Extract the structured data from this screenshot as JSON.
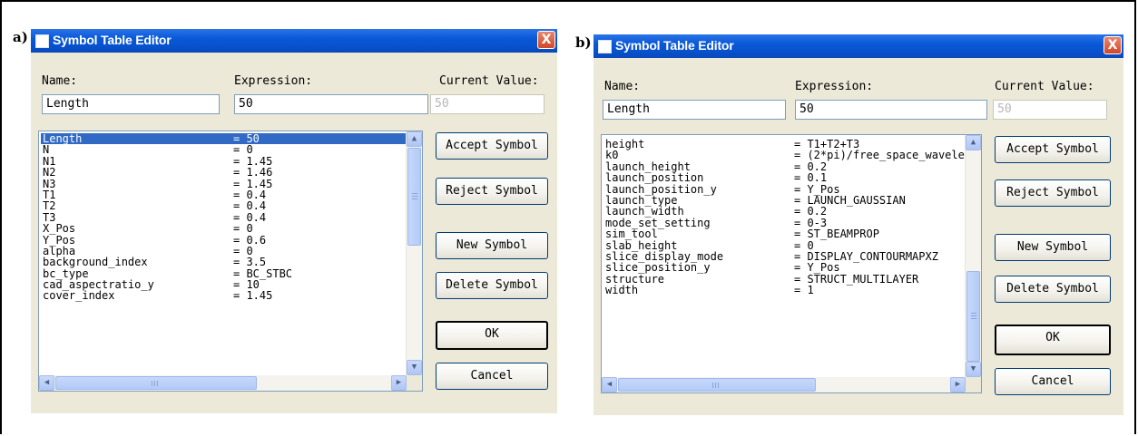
{
  "panels": [
    {
      "label": "a)",
      "title": "Symbol Table Editor",
      "close_glyph": "X",
      "name_label": "Name:",
      "expression_label": "Expression:",
      "current_value_label": "Current Value:",
      "name_value": "Length",
      "expression_value": "50",
      "current_value": "50",
      "buttons": {
        "accept": "Accept Symbol",
        "reject": "Reject Symbol",
        "new": "New Symbol",
        "delete": "Delete Symbol",
        "ok": "OK",
        "cancel": "Cancel"
      },
      "selected_index": 0,
      "symbols": [
        {
          "name": "Length",
          "expr": "= 50"
        },
        {
          "name": "N",
          "expr": "= 0"
        },
        {
          "name": "N1",
          "expr": "= 1.45"
        },
        {
          "name": "N2",
          "expr": "= 1.46"
        },
        {
          "name": "N3",
          "expr": "= 1.45"
        },
        {
          "name": "T1",
          "expr": "= 0.4"
        },
        {
          "name": "T2",
          "expr": "= 0.4"
        },
        {
          "name": "T3",
          "expr": "= 0.4"
        },
        {
          "name": "X_Pos",
          "expr": "= 0"
        },
        {
          "name": "Y_Pos",
          "expr": "= 0.6"
        },
        {
          "name": "alpha",
          "expr": "= 0"
        },
        {
          "name": "background_index",
          "expr": "= 3.5"
        },
        {
          "name": "bc_type",
          "expr": "= BC_STBC"
        },
        {
          "name": "cad_aspectratio_y",
          "expr": "= 10"
        },
        {
          "name": "cover_index",
          "expr": "= 1.45"
        }
      ],
      "scroll": {
        "vertical_position": 0.0,
        "horizontal_position": 0.0
      }
    },
    {
      "label": "b)",
      "title": "Symbol Table Editor",
      "close_glyph": "X",
      "name_label": "Name:",
      "expression_label": "Expression:",
      "current_value_label": "Current Value:",
      "name_value": "Length",
      "expression_value": "50",
      "current_value": "50",
      "buttons": {
        "accept": "Accept Symbol",
        "reject": "Reject Symbol",
        "new": "New Symbol",
        "delete": "Delete Symbol",
        "ok": "OK",
        "cancel": "Cancel"
      },
      "selected_index": -1,
      "symbols": [
        {
          "name": "height",
          "expr": "= T1+T2+T3"
        },
        {
          "name": "k0",
          "expr": "= (2*pi)/free_space_wavele"
        },
        {
          "name": "launch_height",
          "expr": "= 0.2"
        },
        {
          "name": "launch_position",
          "expr": "= 0.1"
        },
        {
          "name": "launch_position_y",
          "expr": "= Y_Pos"
        },
        {
          "name": "launch_type",
          "expr": "= LAUNCH_GAUSSIAN"
        },
        {
          "name": "launch_width",
          "expr": "= 0.2"
        },
        {
          "name": "mode_set_setting",
          "expr": "= 0-3"
        },
        {
          "name": "sim_tool",
          "expr": "= ST_BEAMPROP"
        },
        {
          "name": "slab_height",
          "expr": "= 0"
        },
        {
          "name": "slice_display_mode",
          "expr": "= DISPLAY_CONTOURMAPXZ"
        },
        {
          "name": "slice_position_y",
          "expr": "= Y_Pos"
        },
        {
          "name": "structure",
          "expr": "= STRUCT_MULTILAYER"
        },
        {
          "name": "width",
          "expr": "= 1"
        }
      ],
      "scroll": {
        "vertical_position": 1.0,
        "horizontal_position": 0.0
      }
    }
  ]
}
